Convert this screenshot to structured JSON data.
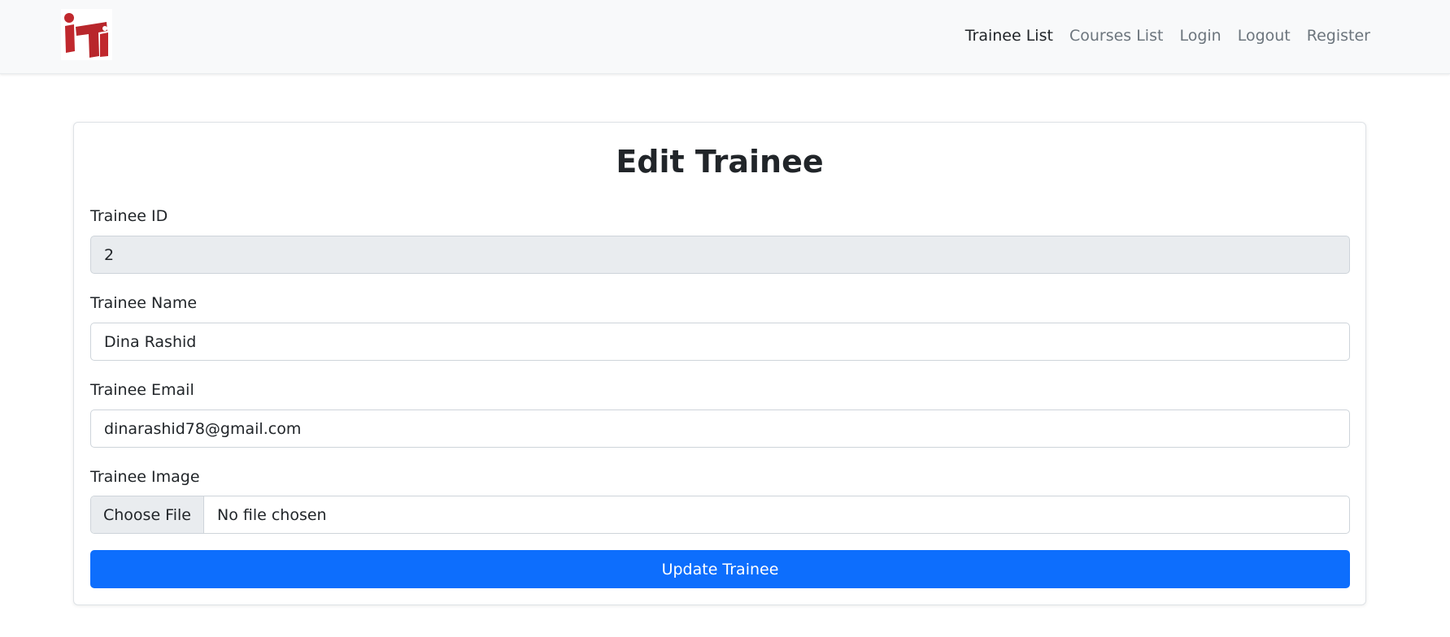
{
  "nav": {
    "logo_text": "iTi",
    "links": [
      "Trainee List",
      "Courses List",
      "Login",
      "Logout",
      "Register"
    ]
  },
  "form": {
    "title": "Edit Trainee",
    "id_label": "Trainee ID",
    "id_value": "2",
    "name_label": "Trainee Name",
    "name_value": "Dina Rashid",
    "email_label": "Trainee Email",
    "email_value": "dinarashid78@gmail.com",
    "image_label": "Trainee Image",
    "file_button": "Choose File",
    "file_status": "No file chosen",
    "submit_label": "Update Trainee"
  },
  "colors": {
    "navbar_bg": "#f8f9fa",
    "primary": "#0d6efd",
    "logo_red": "#c0282d",
    "readonly_bg": "#e9ecef"
  }
}
